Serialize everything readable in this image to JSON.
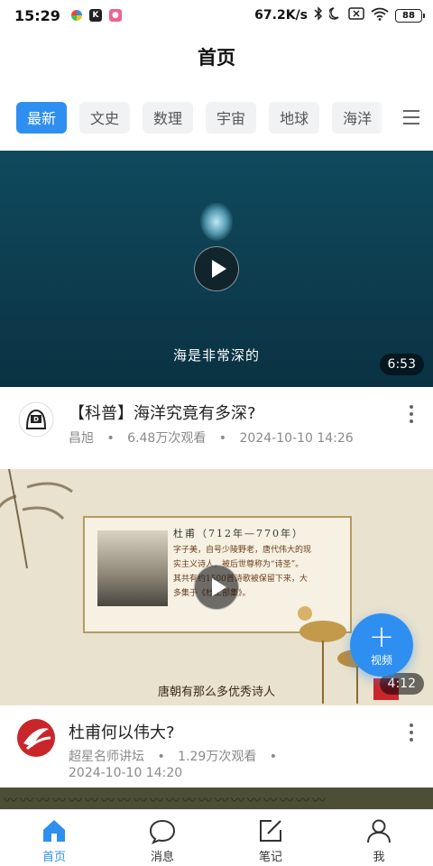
{
  "status_bar": {
    "time": "15:29",
    "network_speed": "67.2K/s",
    "battery": "88"
  },
  "header": {
    "title": "首页"
  },
  "tabs": [
    {
      "label": "最新",
      "active": true
    },
    {
      "label": "文史",
      "active": false
    },
    {
      "label": "数理",
      "active": false
    },
    {
      "label": "宇宙",
      "active": false
    },
    {
      "label": "地球",
      "active": false
    },
    {
      "label": "海洋",
      "active": false
    }
  ],
  "feed": [
    {
      "subtitle": "海是非常深的",
      "duration": "6:53",
      "title": "【科普】海洋究竟有多深?",
      "author": "昌旭",
      "views": "6.48万次观看",
      "date": "2024-10-10 14:26"
    },
    {
      "subtitle": "唐朝有那么多优秀诗人",
      "duration": "4:12",
      "title": "杜甫何以伟大?",
      "author": "超星名师讲坛",
      "views": "1.29万次观看",
      "date": "2024-10-10 14:20",
      "slide_heading": "杜甫（712年—770年）",
      "slide_lines": [
        "字子美，自号少陵野老，唐代伟大的现",
        "实主义诗人，被后世尊称为“诗圣”。",
        "其共有约1500首诗歌被保留下来，大",
        "多集于《杜工部集》。"
      ]
    }
  ],
  "fab": {
    "label": "视频"
  },
  "bottom_nav": [
    {
      "label": "首页",
      "icon": "home-icon",
      "active": true
    },
    {
      "label": "消息",
      "icon": "message-icon",
      "active": false
    },
    {
      "label": "笔记",
      "icon": "note-icon",
      "active": false
    },
    {
      "label": "我",
      "icon": "profile-icon",
      "active": false
    }
  ],
  "colors": {
    "accent": "#2e8ff0"
  }
}
